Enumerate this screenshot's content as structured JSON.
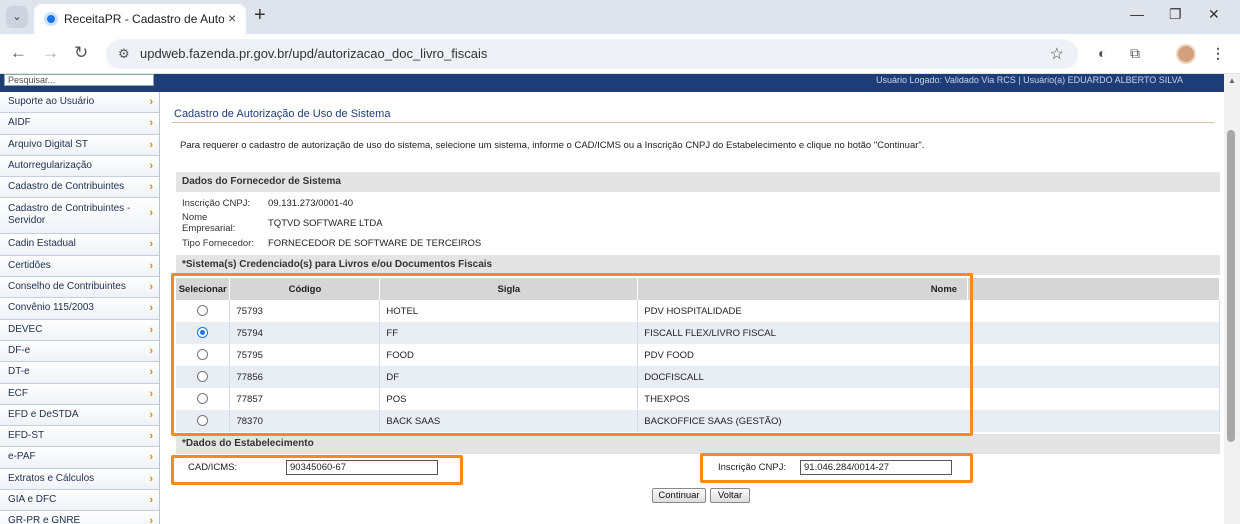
{
  "browser": {
    "tab_title": "ReceitaPR - Cadastro de Autori:",
    "url": "updweb.fazenda.pr.gov.br/upd/autorizacao_doc_livro_fiscais",
    "new_tab_symbol": "+",
    "close_symbol": "×"
  },
  "header": {
    "search_placeholder": "Pesquisar...",
    "band_text": "Usuário Logado: Validado Via RCS  |  Usuário(a) EDUARDO ALBERTO SILVA"
  },
  "sidebar": {
    "items": [
      {
        "label": "Suporte ao Usuário"
      },
      {
        "label": "AIDF"
      },
      {
        "label": "Arquivo Digital ST"
      },
      {
        "label": "Autorregularização"
      },
      {
        "label": "Cadastro de Contribuintes"
      },
      {
        "label": "Cadastro de Contribuintes - Servidor"
      },
      {
        "label": "Cadin Estadual"
      },
      {
        "label": "Certidões"
      },
      {
        "label": "Conselho de Contribuintes"
      },
      {
        "label": "Convênio 115/2003"
      },
      {
        "label": "DEVEC"
      },
      {
        "label": "DF-e"
      },
      {
        "label": "DT-e"
      },
      {
        "label": "ECF"
      },
      {
        "label": "EFD e DeSTDA"
      },
      {
        "label": "EFD-ST"
      },
      {
        "label": "e-PAF"
      },
      {
        "label": "Extratos e Cálculos"
      },
      {
        "label": "GIA e DFC"
      },
      {
        "label": "GR-PR e GNRE"
      }
    ]
  },
  "main": {
    "title": "Cadastro de Autorização de Uso de Sistema",
    "instructions": "Para requerer o cadastro de autorização de uso do sistema, selecione um sistema, informe o CAD/ICMS ou a Inscrição CNPJ do Estabelecimento e clique no botão \"Continuar\".",
    "supplier_header": "Dados do Fornecedor de Sistema",
    "supplier": {
      "cnpj_label": "Inscrição CNPJ:",
      "cnpj_value": "09.131.273/0001-40",
      "name_label": "Nome Empresarial:",
      "name_value": "TQTVD SOFTWARE LTDA",
      "type_label": "Tipo Fornecedor:",
      "type_value": "FORNECEDOR DE SOFTWARE DE TERCEIROS"
    },
    "systems_header": "*Sistema(s) Credenciado(s) para Livros e/ou Documentos Fiscais",
    "table": {
      "columns": [
        "Selecionar",
        "Código",
        "Sigla",
        "Nome"
      ],
      "rows": [
        {
          "codigo": "75793",
          "sigla": "HOTEL",
          "nome": "PDV HOSPITALIDADE",
          "selected": false
        },
        {
          "codigo": "75794",
          "sigla": "FF",
          "nome": "FISCALL FLEX/LIVRO FISCAL",
          "selected": true
        },
        {
          "codigo": "75795",
          "sigla": "FOOD",
          "nome": "PDV FOOD",
          "selected": false
        },
        {
          "codigo": "77856",
          "sigla": "DF",
          "nome": "DOCFISCALL",
          "selected": false
        },
        {
          "codigo": "77857",
          "sigla": "POS",
          "nome": "THEXPOS",
          "selected": false
        },
        {
          "codigo": "78370",
          "sigla": "BACK SAAS",
          "nome": "BACKOFFICE SAAS (GESTÃO)",
          "selected": false
        }
      ]
    },
    "establishment_header": "*Dados do Estabelecimento",
    "cad_icms_label": "CAD/ICMS:",
    "cad_icms_value": "90345060-67",
    "cnpj_label": "Inscrição CNPJ:",
    "cnpj_value": "91.046.284/0014-27",
    "continue_label": "Continuar",
    "back_label": "Voltar"
  },
  "colors": {
    "highlight": "#f58a1f",
    "header_band": "#1d3d78",
    "menu_arrow": "#e08600"
  }
}
